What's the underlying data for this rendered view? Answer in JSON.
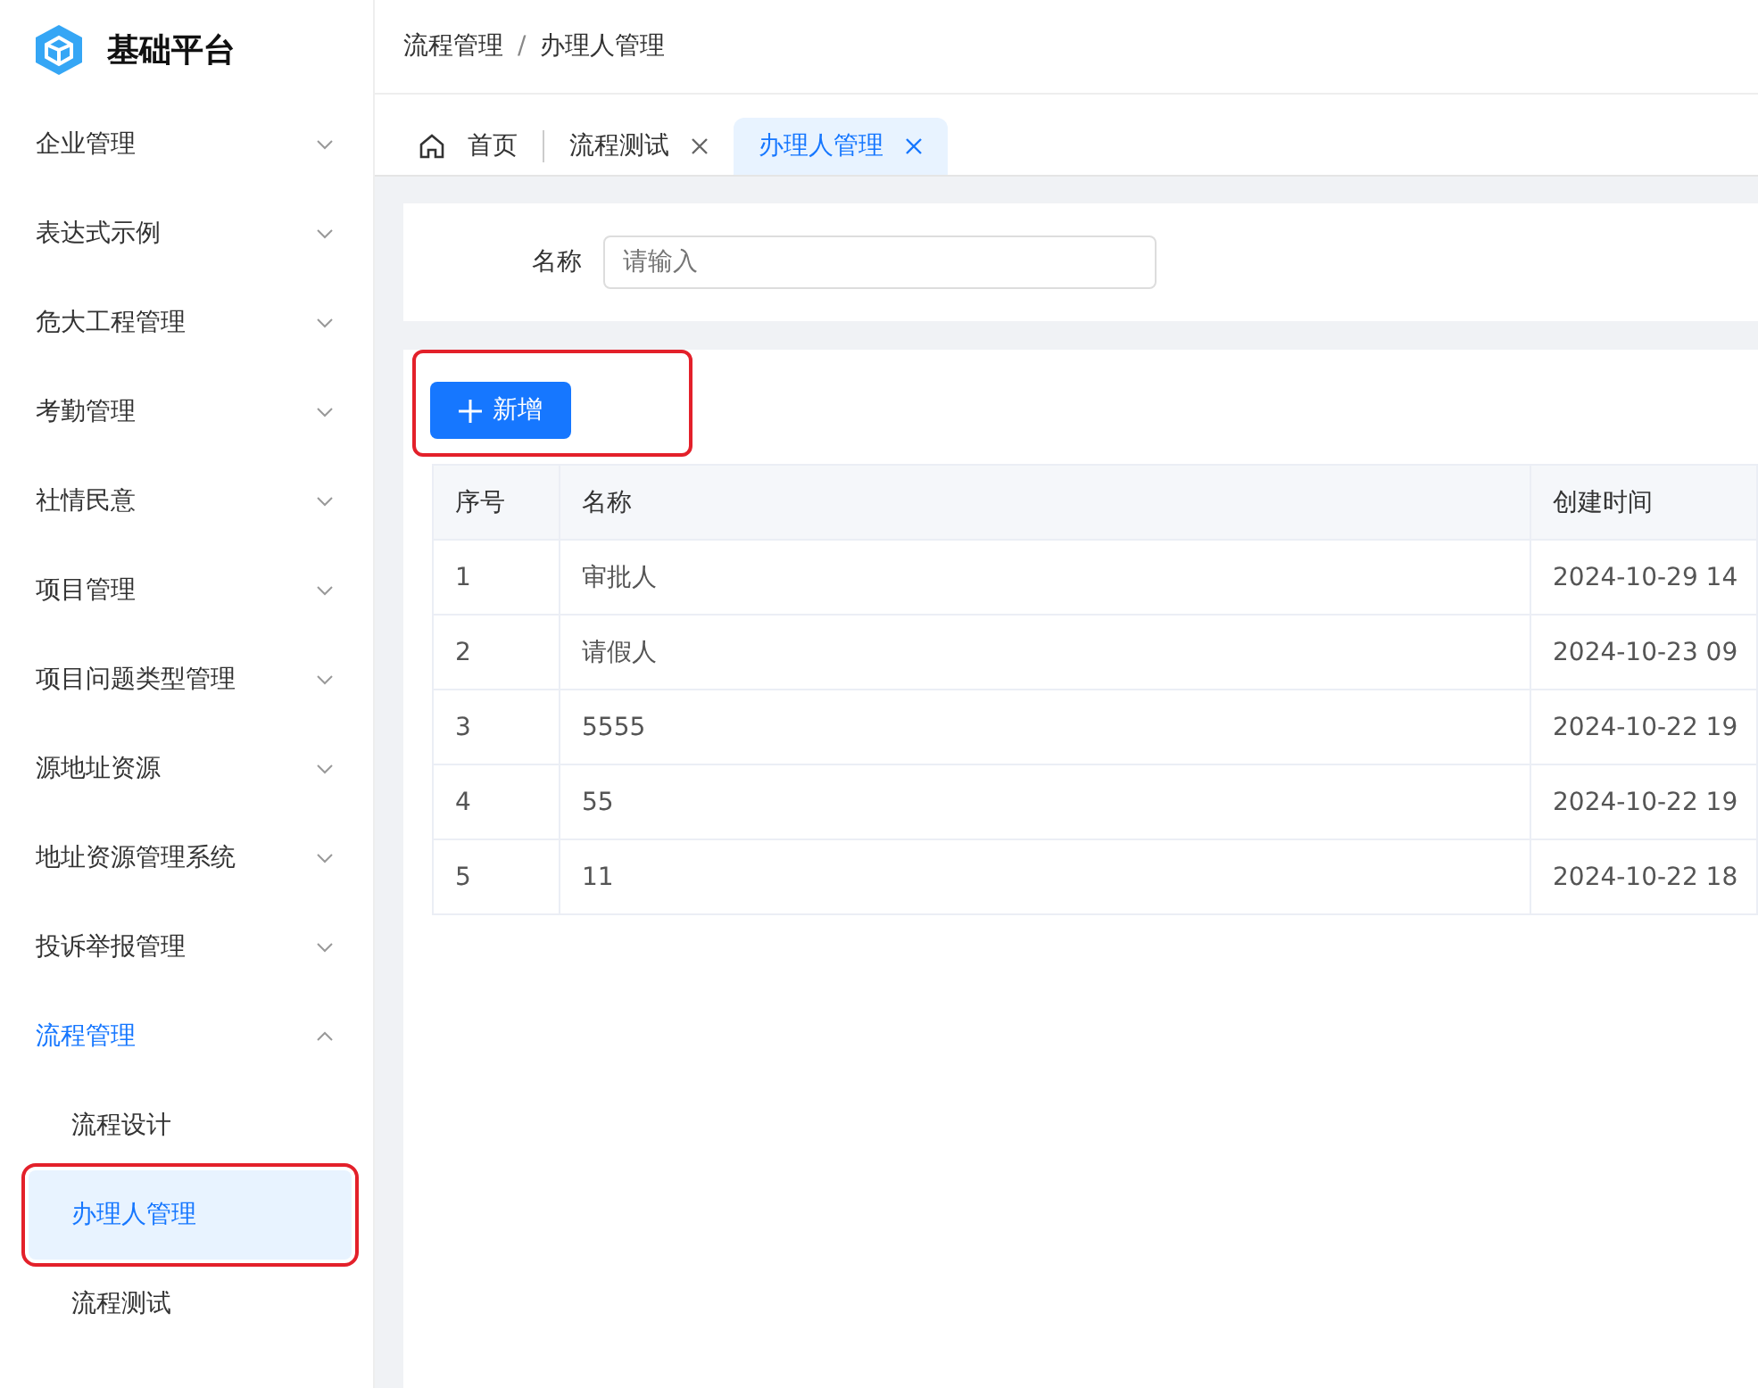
{
  "app": {
    "title": "基础平台"
  },
  "sidebar": {
    "items": [
      {
        "label": "企业管理",
        "expanded": false,
        "selected": false
      },
      {
        "label": "表达式示例",
        "expanded": false,
        "selected": false
      },
      {
        "label": "危大工程管理",
        "expanded": false,
        "selected": false
      },
      {
        "label": "考勤管理",
        "expanded": false,
        "selected": false
      },
      {
        "label": "社情民意",
        "expanded": false,
        "selected": false
      },
      {
        "label": "项目管理",
        "expanded": false,
        "selected": false
      },
      {
        "label": "项目问题类型管理",
        "expanded": false,
        "selected": false
      },
      {
        "label": "源地址资源",
        "expanded": false,
        "selected": false
      },
      {
        "label": "地址资源管理系统",
        "expanded": false,
        "selected": false
      },
      {
        "label": "投诉举报管理",
        "expanded": false,
        "selected": false
      },
      {
        "label": "流程管理",
        "expanded": true,
        "selected": true,
        "children": [
          {
            "label": "流程设计",
            "selected": false,
            "highlighted": false
          },
          {
            "label": "办理人管理",
            "selected": true,
            "highlighted": true
          },
          {
            "label": "流程测试",
            "selected": false,
            "highlighted": false
          }
        ]
      }
    ]
  },
  "breadcrumb": {
    "items": [
      "流程管理",
      "办理人管理"
    ],
    "separator": "/"
  },
  "tabs": [
    {
      "label": "首页",
      "kind": "home",
      "selected": false
    },
    {
      "label": "流程测试",
      "kind": "closable",
      "selected": false
    },
    {
      "label": "办理人管理",
      "kind": "closable",
      "selected": true
    }
  ],
  "search": {
    "label": "名称",
    "placeholder": "请输入"
  },
  "add_button": {
    "label": "新增",
    "highlighted": true
  },
  "table": {
    "columns": [
      "序号",
      "名称",
      "创建时间"
    ],
    "rows": [
      [
        "1",
        "审批人",
        "2024-10-29 14"
      ],
      [
        "2",
        "请假人",
        "2024-10-23 09"
      ],
      [
        "3",
        "5555",
        "2024-10-22 19"
      ],
      [
        "4",
        "55",
        "2024-10-22 19"
      ],
      [
        "5",
        "11",
        "2024-10-22 18"
      ]
    ]
  }
}
